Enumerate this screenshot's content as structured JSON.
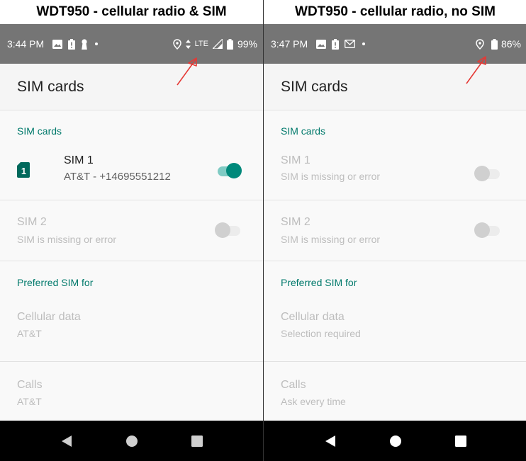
{
  "panels": [
    {
      "caption": "WDT950 - cellular radio & SIM",
      "status": {
        "time": "3:44 PM",
        "network": "LTE",
        "battery": "99%"
      },
      "header": {
        "title": "SIM cards"
      },
      "section_sim": "SIM cards",
      "sim1": {
        "name": "SIM 1",
        "detail": "AT&T - +14695551212",
        "badge": "1",
        "enabled": true
      },
      "sim2": {
        "name": "SIM 2",
        "detail": "SIM is missing or error",
        "enabled": false
      },
      "section_pref": "Preferred SIM for",
      "cellular": {
        "label": "Cellular data",
        "value": "AT&T"
      },
      "calls": {
        "label": "Calls",
        "value": "AT&T"
      }
    },
    {
      "caption": "WDT950 - cellular radio, no SIM",
      "status": {
        "time": "3:47 PM",
        "battery": "86%"
      },
      "header": {
        "title": "SIM cards"
      },
      "section_sim": "SIM cards",
      "sim1": {
        "name": "SIM 1",
        "detail": "SIM is missing or error",
        "enabled": false
      },
      "sim2": {
        "name": "SIM 2",
        "detail": "SIM is missing or error",
        "enabled": false
      },
      "section_pref": "Preferred SIM for",
      "cellular": {
        "label": "Cellular data",
        "value": "Selection required"
      },
      "calls": {
        "label": "Calls",
        "value": "Ask every time"
      }
    }
  ],
  "colors": {
    "accent": "#00897b",
    "status_bar": "#757575",
    "annotation_arrow": "#e53935"
  },
  "icons": [
    "image-icon",
    "battery-alert-icon",
    "keyhole-icon",
    "gmail-icon",
    "dot-icon",
    "location-icon",
    "data-arrows-icon",
    "signal-icon",
    "battery-icon",
    "sim-card-icon",
    "back-icon",
    "home-icon",
    "recents-icon",
    "annotation-arrow"
  ]
}
